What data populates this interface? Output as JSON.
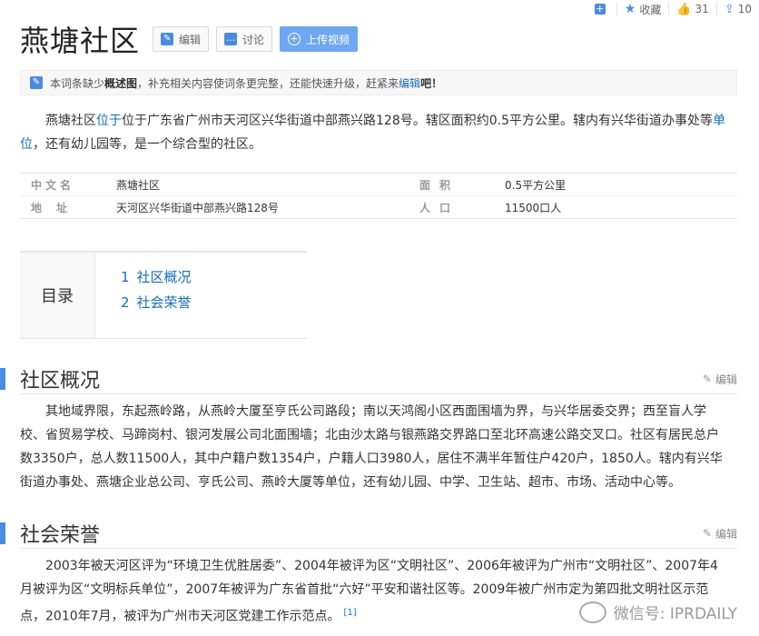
{
  "toolbar": {
    "add_icon": "+",
    "favorite_label": "收藏",
    "like_count": "31",
    "share_count": "10"
  },
  "header": {
    "title": "燕塘社区",
    "edit_label": "编辑",
    "discuss_label": "讨论",
    "upload_label": "上传视频"
  },
  "notice": {
    "prefix": "本词条缺少",
    "bold": "概述图",
    "middle": "，补充相关内容使词条更完整，还能快速升级，赶紧来",
    "link": "编辑",
    "suffix": "吧！"
  },
  "intro": {
    "p1a": "燕塘社区",
    "p1link": "位于",
    "p1b": "位于广东省广州市天河区兴华街道中部燕兴路128号。辖区面积约0.5平方公里。辖内有兴华街道办事处等",
    "p1link2": "单位",
    "p1c": "，还有幼儿园等，是一个综合型的社区。"
  },
  "info": {
    "rows": [
      {
        "k1": "中文名",
        "v1": "燕塘社区",
        "k2": "面积",
        "v2": "0.5平方公里"
      },
      {
        "k1": "地址",
        "v1": "天河区兴华街道中部燕兴路128号",
        "k2": "人口",
        "v2": "11500口人"
      }
    ]
  },
  "toc": {
    "title": "目录",
    "items": [
      {
        "num": "1",
        "label": "社区概况"
      },
      {
        "num": "2",
        "label": "社会荣誉"
      }
    ]
  },
  "sections": [
    {
      "title": "社区概况",
      "edit": "编辑",
      "text": "其地域界限，东起燕岭路，从燕岭大厦至亨氏公司路段；南以天鸿阁小区西面围墙为界，与兴华居委交界；西至盲人学校、省贸易学校、马蹄岗村、银河发展公司北面围墙；北由沙太路与银燕路交界路口至北环高速公路交叉口。社区有居民总户数3350户，总人数11500人，其中户籍户数1354户，户籍人口3980人，居住不满半年暂住户420户，1850人。辖内有兴华街道办事处、燕塘企业总公司、亨氏公司、燕岭大厦等单位，还有幼儿园、中学、卫生站、超市、市场、活动中心等。"
    },
    {
      "title": "社会荣誉",
      "edit": "编辑",
      "text": "2003年被天河区评为“环境卫生优胜居委”、2004年被评为区“文明社区”、2006年被评为广州市“文明社区”、2007年4月被评为区“文明标兵单位”，2007年被评为广东省首批“六好”平安和谐社区等。2009年被广州市定为第四批文明社区示范点，2010年7月，被评为广州市天河区党建工作示范点。",
      "ref": "[1]"
    }
  ],
  "watermark": "微信号: IPRDAILY"
}
